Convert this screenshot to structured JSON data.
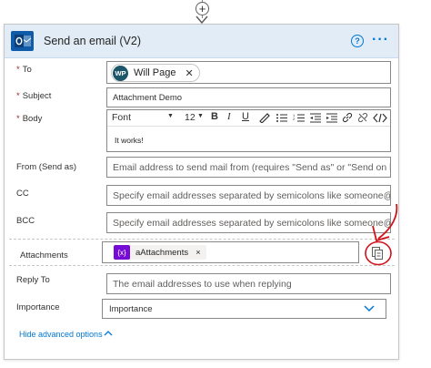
{
  "card": {
    "title": "Send an email (V2)",
    "help_glyph": "?",
    "more_glyph": "···",
    "accent_color": "#0078d4",
    "header_bg": "#e1ecf6",
    "icon": "outlook-icon"
  },
  "fields": {
    "to": {
      "label": "To",
      "required_mark": "*",
      "recipient_initials": "WP",
      "recipient_name": "Will Page",
      "remove_glyph": "✕"
    },
    "subject": {
      "label": "Subject",
      "required_mark": "*",
      "value": "Attachment Demo"
    },
    "body": {
      "label": "Body",
      "required_mark": "*",
      "font": "Font",
      "font_size": "12",
      "bold": "B",
      "italic": "I",
      "underline": "U",
      "text": "It works!"
    },
    "from": {
      "label": "From (Send as)",
      "placeholder": "Email address to send mail from (requires \"Send as\" or \"Send on behalf of\" permission)"
    },
    "cc": {
      "label": "CC",
      "placeholder": "Specify email addresses separated by semicolons like someone@contoso.com"
    },
    "bcc": {
      "label": "BCC",
      "placeholder": "Specify email addresses separated by semicolons like someone@contoso.com"
    },
    "attachments": {
      "label": "Attachments",
      "token_icon": "{x}",
      "token_text": "aAttachments",
      "token_remove": "×"
    },
    "reply_to": {
      "label": "Reply To",
      "placeholder": "The email addresses to use when replying"
    },
    "importance": {
      "label": "Importance",
      "value": "Importance"
    }
  },
  "footer": {
    "hide_advanced": "Hide advanced options"
  },
  "annotation": {
    "color": "#d0121b"
  }
}
